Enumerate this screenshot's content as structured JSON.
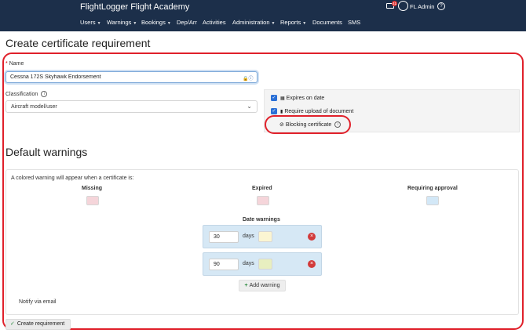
{
  "app": {
    "title": "FlightLogger Flight Academy"
  },
  "nav": [
    {
      "label": "Users",
      "dropdown": true
    },
    {
      "label": "Warnings",
      "dropdown": true
    },
    {
      "label": "Bookings",
      "dropdown": true
    },
    {
      "label": "Dep/Arr",
      "dropdown": false
    },
    {
      "label": "Activities",
      "dropdown": false
    },
    {
      "label": "Administration",
      "dropdown": true
    },
    {
      "label": "Reports",
      "dropdown": true
    },
    {
      "label": "Documents",
      "dropdown": false
    },
    {
      "label": "SMS",
      "dropdown": false
    }
  ],
  "header_right": {
    "mail_badge": "41",
    "user_name": "FL Admin",
    "help_icon": "?"
  },
  "page": {
    "title": "Create certificate requirement"
  },
  "form": {
    "name_label": "Name",
    "required_mark": "*",
    "name_value": "Cessna 172S Skyhawk Endorsement",
    "classification_label": "Classification",
    "classification_value": "Aircraft model/user",
    "options": {
      "expires_on_date": "Expires on date",
      "require_upload": "Require upload of document",
      "blocking_certificate": "Blocking certificate"
    }
  },
  "default_warnings": {
    "title": "Default warnings",
    "intro": "A colored warning will appear when a certificate is:",
    "columns": {
      "missing": "Missing",
      "expired": "Expired",
      "requiring_approval": "Requiring approval"
    },
    "date_warnings_title": "Date warnings",
    "date_warnings": [
      {
        "value": "30",
        "unit": "days"
      },
      {
        "value": "90",
        "unit": "days"
      }
    ],
    "add_warning": "Add warning",
    "notify_via_email": "Notify via email"
  },
  "actions": {
    "create": "Create requirement"
  },
  "colors": {
    "topbar": "#1c2f4a",
    "highlight": "#e0202a",
    "checkbox": "#2a6fd6",
    "missing_swatch": "#f5d5da",
    "expired_swatch": "#f5d5da",
    "approval_swatch": "#d3e8f7",
    "dw30_swatch": "#fbf5d2",
    "dw90_swatch": "#e8efc0",
    "date_row_bg": "#d6e8f5"
  }
}
